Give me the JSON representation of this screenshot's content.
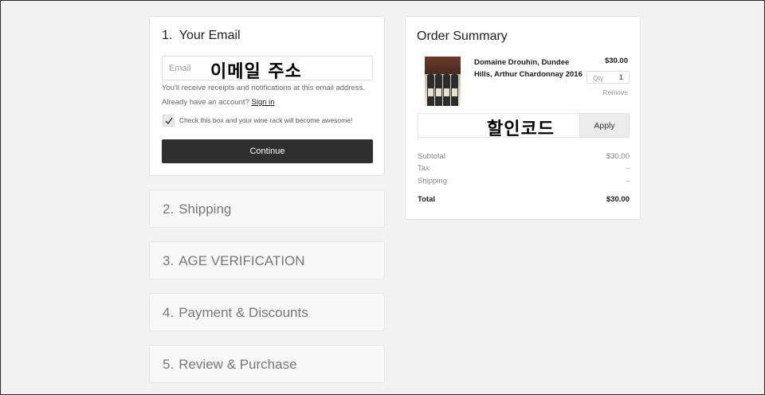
{
  "email_step": {
    "number": "1.",
    "title": "Your Email",
    "email_placeholder": "Email",
    "email_overlay_text": "이메일 주소",
    "receipt_note": "You'll receive receipts and notifications at this email address.",
    "account_prompt": "Already have an account?",
    "sign_in_link": "Sign in",
    "newsletter_checkbox_label": "Check this box and your wine rack will become awesome!",
    "newsletter_checked": true,
    "continue_label": "Continue"
  },
  "steps": [
    {
      "number": "2.",
      "title": "Shipping"
    },
    {
      "number": "3.",
      "title": "AGE VERIFICATION"
    },
    {
      "number": "4.",
      "title": "Payment & Discounts"
    },
    {
      "number": "5.",
      "title": "Review & Purchase"
    }
  ],
  "order_summary": {
    "title": "Order Summary",
    "item": {
      "name": "Domaine Drouhin, Dundee Hills, Arthur Chardonnay 2016",
      "price": "$30.00",
      "qty_label": "Qty",
      "qty_value": "1",
      "remove_label": "Remove"
    },
    "discount_overlay_text": "할인코드",
    "apply_label": "Apply",
    "subtotal_label": "Subtotal",
    "subtotal_value": "$30.00",
    "tax_label": "Tax",
    "tax_value": "-",
    "shipping_label": "Shipping",
    "shipping_value": "-",
    "total_label": "Total",
    "total_value": "$30.00"
  }
}
